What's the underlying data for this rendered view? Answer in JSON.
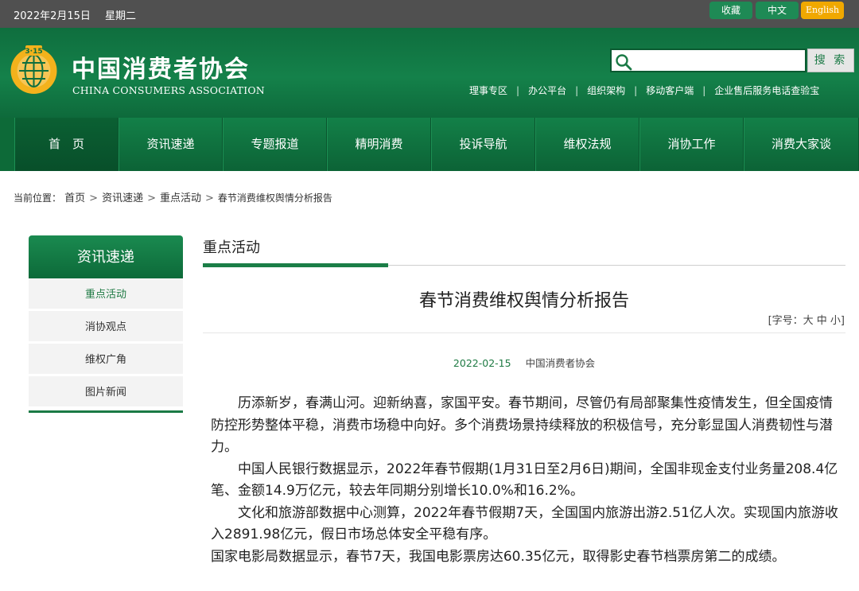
{
  "topbar": {
    "date": "2022年2月15日",
    "weekday": "星期二",
    "favorite_label": "收藏",
    "chinese_label": "中文",
    "english_label": "English"
  },
  "header": {
    "brand_cn": "中国消费者协会",
    "brand_en": "CHINA CONSUMERS ASSOCIATION",
    "logo_text": "3·15",
    "search_placeholder": "",
    "search_button": "搜 索",
    "links": [
      "理事专区",
      "办公平台",
      "组织架构",
      "移动客户端",
      "企业售后服务电话查验宝"
    ]
  },
  "nav": {
    "items": [
      "首　页",
      "资讯速递",
      "专题报道",
      "精明消费",
      "投诉导航",
      "维权法规",
      "消协工作",
      "消费大家谈"
    ],
    "active_index": 0
  },
  "breadcrumb": {
    "label": "当前位置：",
    "items": [
      "首页",
      "资讯速递",
      "重点活动",
      "春节消费维权舆情分析报告"
    ]
  },
  "sidebar": {
    "title": "资讯速递",
    "items": [
      "重点活动",
      "消协观点",
      "维权广角",
      "图片新闻"
    ]
  },
  "section": {
    "title": "重点活动"
  },
  "article": {
    "title": "春节消费维权舆情分析报告",
    "font_size_label": "[字号：大 中 小]",
    "date": "2022-02-15",
    "source": "中国消费者协会",
    "paragraphs": [
      "历添新岁，春满山河。迎新纳喜，家国平安。春节期间，尽管仍有局部聚集性疫情发生，但全国疫情防控形势整体平稳，消费市场稳中向好。多个消费场景持续释放的积极信号，充分彰显国人消费韧性与潜力。",
      "中国人民银行数据显示，2022年春节假期(1月31日至2月6日)期间，全国非现金支付业务量208.4亿笔、金额14.9万亿元，较去年同期分别增长10.0%和16.2%。",
      "文化和旅游部数据中心测算，2022年春节假期7天，全国国内旅游出游2.51亿人次。实现国内旅游收入2891.98亿元，假日市场总体安全平稳有序。",
      "国家电影局数据显示，春节7天，我国电影票房达60.35亿元，取得影史春节档票房第二的成绩。"
    ]
  },
  "colors": {
    "brand_green": "#14814a",
    "topbar": "#505050",
    "english_btn": "#f0a800"
  }
}
